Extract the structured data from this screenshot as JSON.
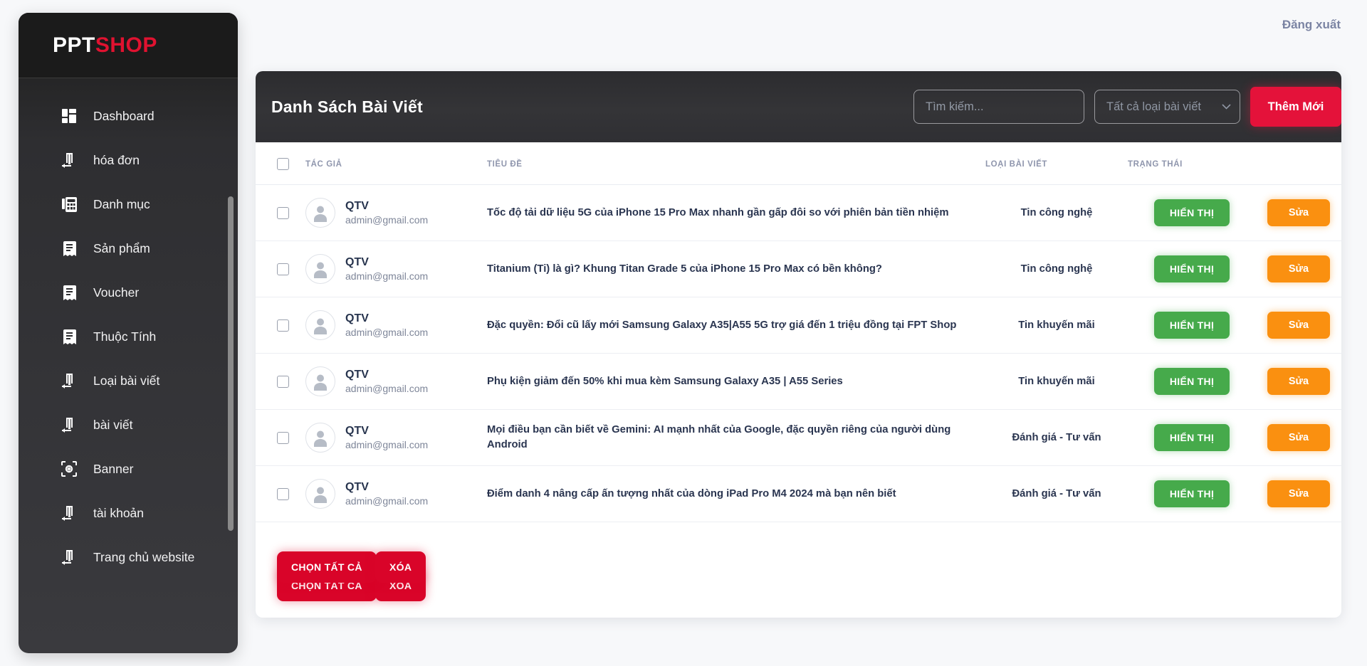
{
  "brand": {
    "part1": "PPT",
    "part2": "SHOP"
  },
  "topbar": {
    "logout_label": "Đăng xuất"
  },
  "sidebar": {
    "items": [
      {
        "label": "Dashboard",
        "icon": "dashboard-icon"
      },
      {
        "label": "hóa đơn",
        "icon": "invoice-icon"
      },
      {
        "label": "Danh mục",
        "icon": "category-icon"
      },
      {
        "label": "Sản phẩm",
        "icon": "product-icon"
      },
      {
        "label": "Voucher",
        "icon": "voucher-icon"
      },
      {
        "label": "Thuộc Tính",
        "icon": "attribute-icon"
      },
      {
        "label": "Loại bài viết",
        "icon": "post-type-icon"
      },
      {
        "label": "bài viết",
        "icon": "post-icon"
      },
      {
        "label": "Banner",
        "icon": "banner-icon"
      },
      {
        "label": "tài khoản",
        "icon": "account-icon"
      },
      {
        "label": "Trang chủ website",
        "icon": "home-icon"
      }
    ]
  },
  "panel": {
    "title": "Danh Sách Bài Viết",
    "search": {
      "value": "",
      "placeholder": "Tìm kiếm..."
    },
    "filter": {
      "selected": "Tất cả loại bài viết"
    },
    "add_button": "Thêm Mới"
  },
  "table": {
    "columns": [
      "",
      "TÁC GIẢ",
      "TIÊU ĐỀ",
      "LOẠI BÀI VIẾT",
      "TRẠNG THÁI",
      ""
    ],
    "rows": [
      {
        "author": "QTV",
        "email": "admin@gmail.com",
        "title": "Tốc độ tải dữ liệu 5G của iPhone 15 Pro Max nhanh gần gấp đôi so với phiên bản tiền nhiệm",
        "category": "Tin công nghệ",
        "status": "HIỂN THỊ",
        "action": "Sửa"
      },
      {
        "author": "QTV",
        "email": "admin@gmail.com",
        "title": "Titanium (Ti) là gì? Khung Titan Grade 5 của iPhone 15 Pro Max có bền không?",
        "category": "Tin công nghệ",
        "status": "HIỂN THỊ",
        "action": "Sửa"
      },
      {
        "author": "QTV",
        "email": "admin@gmail.com",
        "title": "Đặc quyền: Đổi cũ lấy mới Samsung Galaxy A35|A55 5G trợ giá đến 1 triệu đồng tại FPT Shop",
        "category": "Tin khuyến mãi",
        "status": "HIỂN THỊ",
        "action": "Sửa"
      },
      {
        "author": "QTV",
        "email": "admin@gmail.com",
        "title": "Phụ kiện giảm đến 50% khi mua kèm Samsung Galaxy A35 | A55 Series",
        "category": "Tin khuyến mãi",
        "status": "HIỂN THỊ",
        "action": "Sửa"
      },
      {
        "author": "QTV",
        "email": "admin@gmail.com",
        "title": "Mọi điều bạn cần biết về Gemini: AI mạnh nhất của Google, đặc quyền riêng của người dùng Android",
        "category": "Đánh giá - Tư vấn",
        "status": "HIỂN THỊ",
        "action": "Sửa"
      },
      {
        "author": "QTV",
        "email": "admin@gmail.com",
        "title": "Điểm danh 4 nâng cấp ấn tượng nhất của dòng iPad Pro M4 2024 mà bạn nên biết",
        "category": "Đánh giá - Tư vấn",
        "status": "HIỂN THỊ",
        "action": "Sửa"
      }
    ]
  },
  "footer": {
    "select_all_label": "CHỌN TẤT CẢ",
    "delete_label": "XÓA"
  },
  "colors": {
    "brand_red": "#e01230",
    "accent_add": "#e4123a",
    "status_green": "#46aa4b",
    "action_orange": "#fa9010",
    "footer_red": "#d90429",
    "sidebar_dark": "#2e2e31",
    "page_bg": "#f7f8fa"
  }
}
